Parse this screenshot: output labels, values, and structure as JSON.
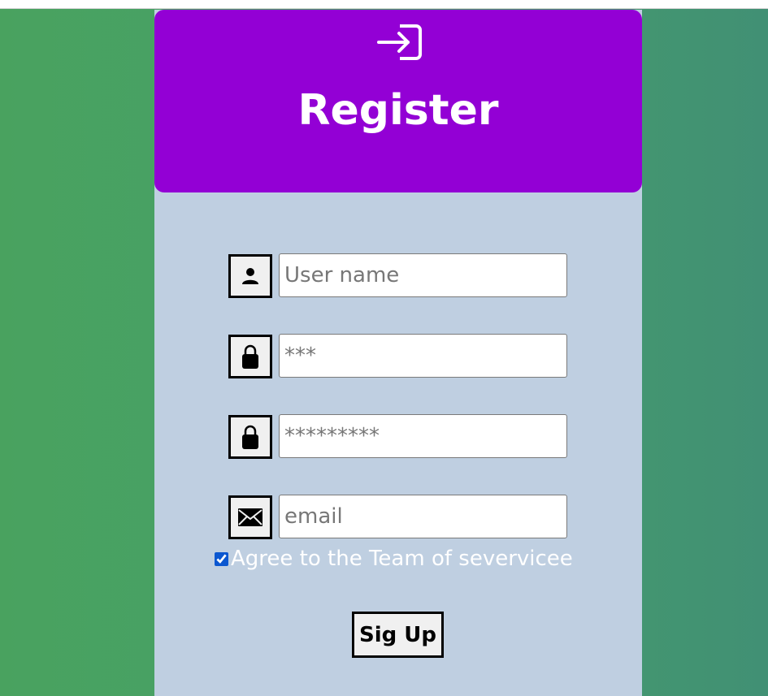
{
  "header": {
    "title": "Register",
    "icon": "login-icon",
    "background_color": "#9300d5"
  },
  "form": {
    "username": {
      "icon": "user-icon",
      "value": "",
      "placeholder": "User name"
    },
    "password": {
      "icon": "lock-icon",
      "value": "",
      "placeholder": "***"
    },
    "confirm_password": {
      "icon": "lock-icon",
      "value": "",
      "placeholder": "*********"
    },
    "email": {
      "icon": "envelope-icon",
      "value": "",
      "placeholder": "email"
    },
    "agree": {
      "label": "Agree to the Team of severvicee",
      "checked": true
    },
    "submit_label": "Sig Up"
  },
  "colors": {
    "page_background": "#47a064",
    "card_background": "#bfcfe1",
    "text_light": "#ffffff"
  }
}
